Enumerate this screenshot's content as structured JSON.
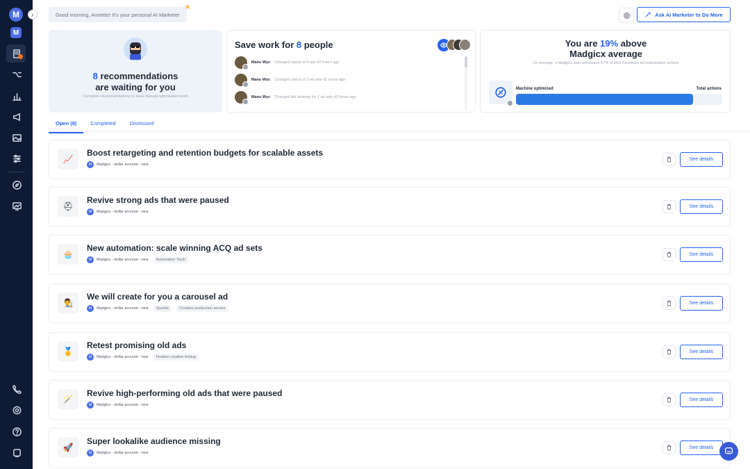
{
  "header": {
    "greeting": "Good morning, Annette! It's your personal AI Marketer",
    "ask_button": "Ask AI Marketer to Do More"
  },
  "sidebar": {
    "logo": "M",
    "items": [
      {
        "icon": "recommendations-icon",
        "active": true
      },
      {
        "icon": "automation-icon"
      },
      {
        "icon": "analytics-icon"
      },
      {
        "icon": "megaphone-icon"
      },
      {
        "icon": "image-icon"
      },
      {
        "icon": "settings-sliders-icon"
      },
      {
        "icon": "compass-icon"
      },
      {
        "icon": "reports-icon"
      },
      {
        "icon": "phone-icon"
      },
      {
        "icon": "gear-icon"
      },
      {
        "icon": "help-icon"
      },
      {
        "icon": "notifications-icon"
      }
    ]
  },
  "cards": {
    "recommendations": {
      "count": "8",
      "line1": "recommendations",
      "line2": "are waiting for you",
      "subtitle": "Complete recommendations to save manual optimization work"
    },
    "save_work": {
      "prefix": "Save work for",
      "count": "8",
      "suffix": "people",
      "activities": [
        {
          "name": "Manu Wyc",
          "text": "Changed status of 4 ads 42 hours ago"
        },
        {
          "name": "Manu Wyc",
          "text": "Changed status of 2 ad sets 42 hours ago"
        },
        {
          "name": "Manu Wyc",
          "text": "Changed bid strategy for 1 ad sets 42 hours ago"
        }
      ]
    },
    "above_average": {
      "prefix": "You are",
      "percent": "19%",
      "suffix": "above",
      "line2": "Madgicx average",
      "subtitle": "On average, a Madgicx user automates 67% of their Facebook ad optimization actions",
      "machine_label": "Machine optimized",
      "total_label": "Total actions",
      "machine_fraction": 0.86
    }
  },
  "tabs": [
    {
      "label": "Open (8)",
      "active": true
    },
    {
      "label": "Completed"
    },
    {
      "label": "Dismissed"
    }
  ],
  "recommendations": [
    {
      "icon": "📈",
      "title": "Boost retargeting and retention budgets for scalable assets",
      "account": "Madgicx - dollar account - new",
      "tags": [],
      "button": "See details"
    },
    {
      "icon": "⛑",
      "title": "Revive strong ads that were paused",
      "account": "Madgicx - dollar account - new",
      "tags": [],
      "button": "See details"
    },
    {
      "icon": "🧁",
      "title": "New automation: scale winning ACQ ad sets",
      "account": "Madgicx - dollar account - new",
      "tags": [
        "Automation Tactic"
      ],
      "button": "See details"
    },
    {
      "icon": "👨‍🎨",
      "title": "We will create for you a carousel ad",
      "account": "Madgicx - dollar account - new",
      "tags": [
        "Sparkle",
        "Creative production service"
      ],
      "button": "See details"
    },
    {
      "icon": "🥇",
      "title": "Retest promising old ads",
      "account": "Madgicx - dollar account - new",
      "tags": [
        "Finalize creative testing"
      ],
      "button": "See details"
    },
    {
      "icon": "🪄",
      "title": "Revive high-performing old ads that were paused",
      "account": "Madgicx - dollar account - new",
      "tags": [],
      "button": "See details"
    },
    {
      "icon": "🚀",
      "title": "Super lookalike audience missing",
      "account": "Madgicx - dollar account - new",
      "tags": [],
      "button": "See details"
    }
  ],
  "colors": {
    "accent": "#2563eb",
    "sidebar": "#0f1b35",
    "card_bg": "#eef3fa"
  }
}
